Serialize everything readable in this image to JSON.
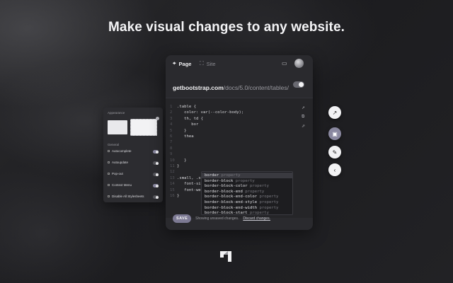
{
  "headline": "Make visual changes to any website.",
  "tabs": {
    "page": "Page",
    "site": "Site"
  },
  "url": {
    "host": "getbootstrap.com",
    "path": "/docs/5.0/content/tables/"
  },
  "code_lines": [
    {
      "n": "1",
      "text": ".table {"
    },
    {
      "n": "2",
      "text": "   color: var(--color-body);"
    },
    {
      "n": "3",
      "text": "   th, td {"
    },
    {
      "n": "4",
      "text": "      bor"
    },
    {
      "n": "5",
      "text": "   }"
    },
    {
      "n": "6",
      "text": "   thea"
    },
    {
      "n": "7",
      "text": ""
    },
    {
      "n": "8",
      "text": ""
    },
    {
      "n": "9",
      "text": ""
    },
    {
      "n": "10",
      "text": "   }"
    },
    {
      "n": "11",
      "text": "}"
    },
    {
      "n": "12",
      "text": ""
    },
    {
      "n": "13",
      "text": ".small, .small {"
    },
    {
      "n": "14",
      "text": "   font-size: 0.875em;"
    },
    {
      "n": "15",
      "text": "   font-weight: inherit;"
    },
    {
      "n": "16",
      "text": "}"
    }
  ],
  "autocomplete": [
    {
      "name": "border",
      "hint": "property"
    },
    {
      "name": "border-block",
      "hint": "property"
    },
    {
      "name": "border-block-color",
      "hint": "property"
    },
    {
      "name": "border-block-end",
      "hint": "property"
    },
    {
      "name": "border-block-end-color",
      "hint": "property"
    },
    {
      "name": "border-block-end-style",
      "hint": "property"
    },
    {
      "name": "border-block-end-width",
      "hint": "property"
    },
    {
      "name": "border-block-start",
      "hint": "property"
    }
  ],
  "footer": {
    "save_label": "SAVE",
    "status": "Showing unsaved changes.",
    "discard": "Discard changes."
  },
  "left_panel": {
    "title": "Appearance",
    "general": "General",
    "rows": [
      {
        "label": "Autocomplete",
        "on": true
      },
      {
        "label": "Autoupdate",
        "on": false
      },
      {
        "label": "Pop-out",
        "on": false
      },
      {
        "label": "Context Menu",
        "on": true
      },
      {
        "label": "Disable All Stylesheets",
        "on": false
      }
    ]
  },
  "icons": {
    "page_tab": "crosshair-icon",
    "site_tab": "frame-icon",
    "docs": "book-icon",
    "fab1": "arrow-up-right-icon",
    "fab2": "inspect-icon",
    "fab3": "pencil-icon",
    "fab4": "chevron-left-icon"
  },
  "colors": {
    "accent": "#8a88a0",
    "panel": "#2a2a2e",
    "background": "#1f1f22"
  }
}
